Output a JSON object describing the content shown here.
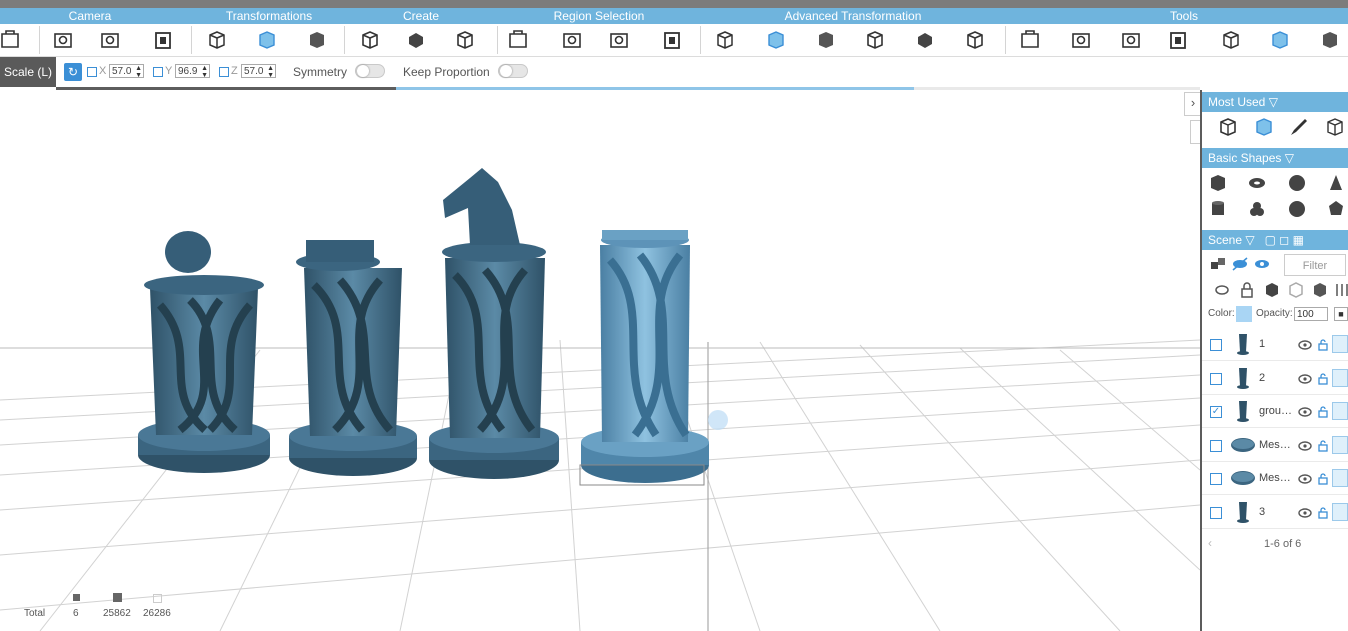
{
  "categories": [
    "Camera",
    "Transformations",
    "Create",
    "Region Selection",
    "Advanced Transformation",
    "Tools"
  ],
  "toolbar_icons": [
    "camera-front-icon",
    "camera-reset-icon",
    "camera-snapshot-icon",
    "camera-frame-icon",
    "transform-move-icon",
    "transform-scale-icon",
    "transform-rotate-icon",
    "create-box-icon",
    "create-extrude-icon",
    "create-mesh-icon",
    "region-cube-icon",
    "region-select-icon",
    "region-bound-icon",
    "region-cut-icon",
    "adv-shape-1-icon",
    "adv-shape-2-icon",
    "adv-shape-3-icon",
    "adv-shape-4-icon",
    "adv-shape-5-icon",
    "adv-shape-6-icon",
    "tool-1-icon",
    "tool-2-icon",
    "tool-3-icon",
    "tool-4-icon",
    "tool-5-icon",
    "tool-6-icon",
    "tool-7-icon"
  ],
  "scale": {
    "label": "Scale (L)",
    "reset_icon": "refresh-icon",
    "x_label": "X",
    "x_value": "57.0",
    "y_label": "Y",
    "y_value": "96.9",
    "z_label": "Z",
    "z_value": "57.0",
    "symmetry": "Symmetry",
    "keep_proportion": "Keep Proportion"
  },
  "progress": 0.75,
  "panel": {
    "most_used": "Most Used",
    "basic_shapes": "Basic Shapes",
    "scene": "Scene",
    "filter_placeholder": "Filter",
    "color_label": "Color:",
    "opacity_label": "Opacity:",
    "opacity_value": "100",
    "accent": "#6fb4dd",
    "objects": [
      {
        "name": "1",
        "checked": false,
        "thumb": "pawn"
      },
      {
        "name": "2",
        "checked": false,
        "thumb": "rook"
      },
      {
        "name": "grou…",
        "checked": true,
        "thumb": "lattice"
      },
      {
        "name": "Mes…",
        "checked": false,
        "thumb": "disc"
      },
      {
        "name": "Mes…",
        "checked": false,
        "thumb": "disc"
      },
      {
        "name": "3",
        "checked": false,
        "thumb": "knight"
      }
    ],
    "paging": "1-6 of 6"
  },
  "stats": {
    "total": "Total",
    "objects": "6",
    "vertices": "25862",
    "faces": "26286"
  }
}
